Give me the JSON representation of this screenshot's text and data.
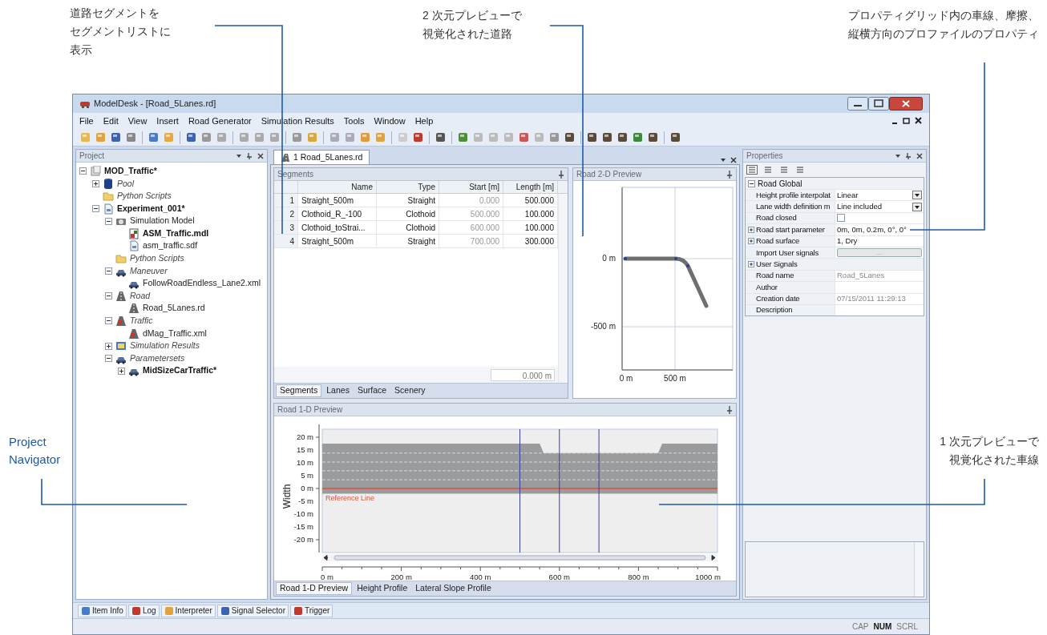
{
  "callouts": [
    {
      "lines": [
        "道路セグメントを",
        "セグメントリストに",
        "表示"
      ]
    },
    {
      "lines": [
        "2 次元プレビューで",
        "視覚化された道路"
      ]
    },
    {
      "lines": [
        "プロパティグリッド内の車線、摩擦、",
        "縦横方向のプロファイルのプロパティ"
      ]
    },
    {
      "lines": [
        "Project",
        "Navigator"
      ]
    },
    {
      "lines": [
        "1 次元プレビューで",
        "視覚化された車線"
      ]
    }
  ],
  "window": {
    "title": "ModelDesk - [Road_5Lanes.rd]"
  },
  "menu": [
    "File",
    "Edit",
    "View",
    "Insert",
    "Road Generator",
    "Simulation Results",
    "Tools",
    "Window",
    "Help"
  ],
  "project_panel": {
    "title": "Project",
    "tree": [
      {
        "label": "MOD_Traffic*",
        "kind": "item",
        "active": true,
        "expanded": true,
        "children": [
          {
            "label": "Pool",
            "kind": "group",
            "active": false,
            "expanded": false
          },
          {
            "label": "Python Scripts",
            "kind": "group",
            "active": false
          },
          {
            "label": "Experiment_001*",
            "kind": "item",
            "active": true,
            "expanded": true,
            "children": [
              {
                "label": "Simulation Model",
                "kind": "item",
                "active": false,
                "expanded": true,
                "children": [
                  {
                    "label": "ASM_Traffic.mdl",
                    "kind": "item",
                    "active": true
                  },
                  {
                    "label": "asm_traffic.sdf",
                    "kind": "item",
                    "active": false
                  }
                ]
              },
              {
                "label": "Python Scripts",
                "kind": "group",
                "active": false
              },
              {
                "label": "Maneuver",
                "kind": "group",
                "active": false,
                "expanded": true,
                "children": [
                  {
                    "label": "FollowRoadEndless_Lane2.xml",
                    "kind": "item",
                    "active": false
                  }
                ]
              },
              {
                "label": "Road",
                "kind": "group",
                "active": false,
                "expanded": true,
                "children": [
                  {
                    "label": "Road_5Lanes.rd",
                    "kind": "item",
                    "active": false
                  }
                ]
              },
              {
                "label": "Traffic",
                "kind": "group",
                "active": false,
                "expanded": true,
                "children": [
                  {
                    "label": "dMag_Traffic.xml",
                    "kind": "item",
                    "active": false
                  }
                ]
              },
              {
                "label": "Simulation Results",
                "kind": "group",
                "active": false,
                "expanded": false
              },
              {
                "label": "Parametersets",
                "kind": "group",
                "active": false,
                "expanded": true,
                "children": [
                  {
                    "label": "MidSizeCarTraffic*",
                    "kind": "item",
                    "active": true,
                    "expanded": false
                  }
                ]
              }
            ]
          }
        ]
      }
    ]
  },
  "document_tab": {
    "label": "1 Road_5Lanes.rd"
  },
  "segments": {
    "title": "Segments",
    "columns": [
      "",
      "Name",
      "Type",
      "Start [m]",
      "Length [m]"
    ],
    "rows": [
      [
        "1",
        "Straight_500m",
        "Straight",
        "0.000",
        "500.000"
      ],
      [
        "2",
        "Clothoid_R_-100",
        "Clothoid",
        "500.000",
        "100.000"
      ],
      [
        "3",
        "Clothoid_toStrai...",
        "Clothoid",
        "600.000",
        "100.000"
      ],
      [
        "4",
        "Straight_500m",
        "Straight",
        "700.000",
        "300.000"
      ]
    ],
    "total": "0.000 m",
    "tabs": [
      {
        "label": "Segments",
        "selected": true
      },
      {
        "label": "Lanes",
        "selected": false
      },
      {
        "label": "Surface",
        "selected": false
      },
      {
        "label": "Scenery",
        "selected": false
      }
    ]
  },
  "preview_2d": {
    "title": "Road 2-D Preview",
    "y_ticks": [
      "0 m",
      "-500 m"
    ],
    "x_ticks": [
      "0 m",
      "500 m"
    ]
  },
  "preview_1d": {
    "title": "Road 1-D Preview",
    "ylabel": "Width",
    "y_ticks": [
      "20 m",
      "15 m",
      "10 m",
      "5 m",
      "0 m",
      "-5 m",
      "-10 m",
      "-15 m",
      "-20 m"
    ],
    "x_ticks": [
      "0 m",
      "200 m",
      "400 m",
      "600 m",
      "800 m",
      "1000 m"
    ],
    "reference_label": "Reference Line",
    "tabs": [
      {
        "label": "Road 1-D Preview",
        "selected": true
      },
      {
        "label": "Height Profile",
        "selected": false
      },
      {
        "label": "Lateral Slope Profile",
        "selected": false
      }
    ]
  },
  "properties": {
    "title": "Properties",
    "category": "Road Global",
    "rows": [
      {
        "name": "Height profile interpolat",
        "value": "Linear",
        "kind": "dropdown"
      },
      {
        "name": "Lane width definition m",
        "value": "Line included",
        "kind": "dropdown"
      },
      {
        "name": "Road closed",
        "kind": "checkbox",
        "checked": false
      },
      {
        "name": "Road start parameter",
        "value": "0m, 0m, 0.2m, 0°, 0°",
        "kind": "expandable",
        "expanded": false
      },
      {
        "name": "Road surface",
        "value": "1, Dry",
        "kind": "expandable",
        "expanded": false
      },
      {
        "name": "Import User signals",
        "value": "...",
        "kind": "button"
      },
      {
        "name": "User Signals",
        "kind": "group",
        "expanded": false
      },
      {
        "name": "Road name",
        "value": "Road_5Lanes",
        "kind": "readonly"
      },
      {
        "name": "Author",
        "kind": "text"
      },
      {
        "name": "Creation date",
        "value": "07/15/2011 11:29:13",
        "kind": "readonly"
      },
      {
        "name": "Description",
        "kind": "text"
      }
    ]
  },
  "bottom_tabs": [
    "Item Info",
    "Log",
    "Interpreter",
    "Signal Selector",
    "Trigger"
  ],
  "status_bar": [
    {
      "label": "CAP",
      "on": false
    },
    {
      "label": "NUM",
      "on": true
    },
    {
      "label": "SCRL",
      "on": false
    }
  ]
}
